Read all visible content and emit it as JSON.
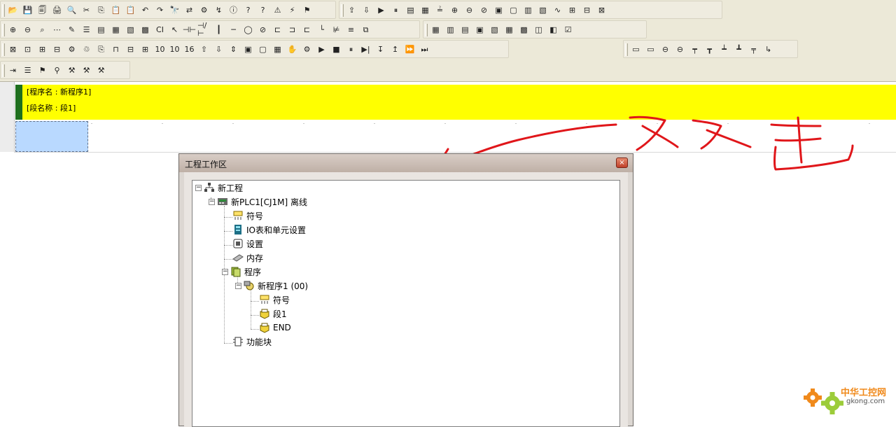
{
  "toolbar": {
    "row1": [
      {
        "name": "open-icon",
        "glyph": "📂"
      },
      {
        "name": "save-icon",
        "glyph": "💾"
      },
      {
        "name": "compare-icon",
        "glyph": "🗐"
      },
      {
        "name": "print-icon",
        "glyph": "🖨"
      },
      {
        "name": "print-preview-icon",
        "glyph": "🔍"
      },
      {
        "name": "cut-icon",
        "glyph": "✂"
      },
      {
        "name": "copy-icon",
        "glyph": "⎘"
      },
      {
        "name": "paste-icon",
        "glyph": "📋"
      },
      {
        "name": "paste-special-icon",
        "glyph": "📋"
      },
      {
        "name": "undo-icon",
        "glyph": "↶"
      },
      {
        "name": "redo-icon",
        "glyph": "↷"
      },
      {
        "name": "find-icon",
        "glyph": "🔭"
      },
      {
        "name": "replace-icon",
        "glyph": "⇄"
      },
      {
        "name": "cross-reference-icon",
        "glyph": "⚙"
      },
      {
        "name": "jump-icon",
        "glyph": "↯"
      },
      {
        "name": "about-icon",
        "glyph": "ⓘ"
      },
      {
        "name": "help-icon",
        "glyph": "?"
      },
      {
        "name": "context-help-icon",
        "glyph": "?"
      },
      {
        "name": "warning-icon",
        "glyph": "⚠"
      },
      {
        "name": "online-icon",
        "glyph": "⚡"
      },
      {
        "name": "monitor-icon",
        "glyph": "⚑"
      },
      {
        "name": "transfer-to-plc-icon",
        "glyph": "⇪"
      },
      {
        "name": "transfer-from-plc-icon",
        "glyph": "⇩"
      },
      {
        "name": "run-mode-icon",
        "glyph": "▶"
      },
      {
        "name": "pause-icon",
        "glyph": "⏸"
      },
      {
        "name": "program-mode-icon",
        "glyph": "▤"
      },
      {
        "name": "monitor-mode-icon",
        "glyph": "▦"
      },
      {
        "name": "compare-plc-icon",
        "glyph": "≟"
      },
      {
        "name": "force-on-icon",
        "glyph": "⊕"
      },
      {
        "name": "force-off-icon",
        "glyph": "⊖"
      },
      {
        "name": "force-cancel-icon",
        "glyph": "⊘"
      },
      {
        "name": "set-icon",
        "glyph": "▣"
      },
      {
        "name": "reset-icon",
        "glyph": "▢"
      },
      {
        "name": "change-value-icon",
        "glyph": "▥"
      },
      {
        "name": "differential-icon",
        "glyph": "▧"
      },
      {
        "name": "trace-icon",
        "glyph": "∿"
      },
      {
        "name": "time-chart-icon",
        "glyph": "⊞"
      },
      {
        "name": "data-trace-icon",
        "glyph": "⊟"
      },
      {
        "name": "io-monitor-icon",
        "glyph": "⊠"
      }
    ],
    "row2": [
      {
        "name": "zoom-in-icon",
        "glyph": "⊕"
      },
      {
        "name": "zoom-out-icon",
        "glyph": "⊖"
      },
      {
        "name": "zoom-fit-icon",
        "glyph": "⌕"
      },
      {
        "name": "grid-icon",
        "glyph": "⋯"
      },
      {
        "name": "comment-icon",
        "glyph": "✎"
      },
      {
        "name": "rung-comment-icon",
        "glyph": "☰"
      },
      {
        "name": "io-comment-icon",
        "glyph": "▤"
      },
      {
        "name": "program-window-icon",
        "glyph": "▦"
      },
      {
        "name": "section-icon",
        "glyph": "▧"
      },
      {
        "name": "symbol-table-icon",
        "glyph": "▩"
      },
      {
        "name": "ci-icon",
        "glyph": "CI"
      },
      {
        "name": "select-icon",
        "glyph": "↖"
      },
      {
        "name": "contact-no-icon",
        "glyph": "⊣⊢"
      },
      {
        "name": "contact-nc-icon",
        "glyph": "⊣/⊢"
      },
      {
        "name": "vertical-line-icon",
        "glyph": "┃"
      },
      {
        "name": "horizontal-line-icon",
        "glyph": "─"
      },
      {
        "name": "coil-icon",
        "glyph": "◯"
      },
      {
        "name": "coil-nc-icon",
        "glyph": "⊘"
      },
      {
        "name": "instruction-icon",
        "glyph": "⊏"
      },
      {
        "name": "pt-icon",
        "glyph": "⊐"
      },
      {
        "name": "jump-line-icon",
        "glyph": "⊏"
      },
      {
        "name": "line-connect-icon",
        "glyph": "└"
      },
      {
        "name": "line-delete-icon",
        "glyph": "⊭"
      },
      {
        "name": "mnemonic-icon",
        "glyph": "≡"
      },
      {
        "name": "build-icon",
        "glyph": "⧉"
      },
      {
        "name": "compile-icon",
        "glyph": "▦"
      },
      {
        "name": "local-var-icon",
        "glyph": "▥"
      },
      {
        "name": "global-var-icon",
        "glyph": "▤"
      },
      {
        "name": "variable-icon",
        "glyph": "▣"
      },
      {
        "name": "output-icon",
        "glyph": "▧"
      },
      {
        "name": "io-table-icon",
        "glyph": "▦"
      },
      {
        "name": "cross-ref-window-icon",
        "glyph": "▩"
      },
      {
        "name": "watch-icon",
        "glyph": "◫"
      },
      {
        "name": "memory-icon",
        "glyph": "◧"
      },
      {
        "name": "settings-icon",
        "glyph": "☑"
      }
    ],
    "row3": [
      {
        "name": "project-workspace-icon",
        "glyph": "⊠"
      },
      {
        "name": "output-window-icon",
        "glyph": "⊡"
      },
      {
        "name": "watch-window-icon",
        "glyph": "⊞"
      },
      {
        "name": "address-window-icon",
        "glyph": "⊟"
      },
      {
        "name": "properties-icon",
        "glyph": "⚙"
      },
      {
        "name": "view-symbols-icon",
        "glyph": "♲"
      },
      {
        "name": "view-comments-icon",
        "glyph": "⎘"
      },
      {
        "name": "view-rung-icon",
        "glyph": "⊓"
      },
      {
        "name": "view-bar-icon",
        "glyph": "⊟"
      },
      {
        "name": "view-table-icon",
        "glyph": "⊞"
      },
      {
        "name": "view-10-icon",
        "glyph": "10"
      },
      {
        "name": "view-10b-icon",
        "glyph": "10"
      },
      {
        "name": "view-16-icon",
        "glyph": "16"
      },
      {
        "name": "transfer-up-icon",
        "glyph": "⇧"
      },
      {
        "name": "transfer-down-icon",
        "glyph": "⇩"
      },
      {
        "name": "transfer-compare-icon",
        "glyph": "⇕"
      },
      {
        "name": "plc-online-icon",
        "glyph": "▣"
      },
      {
        "name": "plc-offline-icon",
        "glyph": "▢"
      },
      {
        "name": "plc-monitor-icon",
        "glyph": "▦"
      },
      {
        "name": "hand-icon",
        "glyph": "✋"
      },
      {
        "name": "sim-icon",
        "glyph": "⚙"
      },
      {
        "name": "play-icon",
        "glyph": "▶"
      },
      {
        "name": "stop-icon",
        "glyph": "■"
      },
      {
        "name": "pause-icon-2",
        "glyph": "⏸"
      },
      {
        "name": "step-in-icon",
        "glyph": "▶|"
      },
      {
        "name": "step-over-icon",
        "glyph": "↧"
      },
      {
        "name": "step-out-icon",
        "glyph": "↥"
      },
      {
        "name": "continuous-step-icon",
        "glyph": "⏩"
      },
      {
        "name": "scan-icon",
        "glyph": "⏭"
      }
    ],
    "row3b": [
      {
        "name": "insert-row-icon",
        "glyph": "▭"
      },
      {
        "name": "insert-column-icon",
        "glyph": "▭"
      },
      {
        "name": "delete-row-icon",
        "glyph": "⊖"
      },
      {
        "name": "delete-column-icon",
        "glyph": "⊖"
      },
      {
        "name": "insert-rung-icon",
        "glyph": "┯"
      },
      {
        "name": "append-rung-icon",
        "glyph": "┳"
      },
      {
        "name": "split-rung-icon",
        "glyph": "┷"
      },
      {
        "name": "merge-rung-icon",
        "glyph": "┻"
      },
      {
        "name": "rung-marker-icon",
        "glyph": "╤"
      },
      {
        "name": "return-icon",
        "glyph": "↳"
      }
    ],
    "row4": [
      {
        "name": "indent-icon",
        "glyph": "⇥"
      },
      {
        "name": "list-icon",
        "glyph": "☰"
      },
      {
        "name": "bookmark-icon",
        "glyph": "⚑"
      },
      {
        "name": "tool-pin-icon",
        "glyph": "⚲"
      },
      {
        "name": "tool-a-icon",
        "glyph": "⚒"
      },
      {
        "name": "tool-b-icon",
        "glyph": "⚒"
      },
      {
        "name": "tool-c-icon",
        "glyph": "⚒"
      }
    ]
  },
  "editor": {
    "program_name_line": "[程序名 : 新程序1]",
    "section_name_line": "[段名称 : 段1]"
  },
  "annotation": {
    "text": "双击",
    "color": "#e0161a"
  },
  "workspace": {
    "title": "工程工作区",
    "close_glyph": "×",
    "tree": [
      {
        "id": "project",
        "label": "新工程",
        "icon": "network-icon",
        "expander": "−"
      },
      {
        "id": "plc",
        "label": "新PLC1[CJ1M] 离线",
        "icon": "plc-icon",
        "expander": "−"
      },
      {
        "id": "symbols",
        "label": "符号",
        "icon": "symbols-icon"
      },
      {
        "id": "io-table",
        "label": "IO表和单元设置",
        "icon": "io-table-icon"
      },
      {
        "id": "settings",
        "label": "设置",
        "icon": "settings-icon"
      },
      {
        "id": "memory",
        "label": "内存",
        "icon": "memory-icon"
      },
      {
        "id": "programs",
        "label": "程序",
        "icon": "programs-icon",
        "expander": "−"
      },
      {
        "id": "new-program",
        "label": "新程序1 (00)",
        "icon": "program-icon",
        "expander": "−"
      },
      {
        "id": "program-symbols",
        "label": "符号",
        "icon": "symbols-icon"
      },
      {
        "id": "section1",
        "label": "段1",
        "icon": "section-icon"
      },
      {
        "id": "end",
        "label": "END",
        "icon": "section-icon"
      },
      {
        "id": "function-blocks",
        "label": "功能块",
        "icon": "function-block-icon"
      }
    ]
  },
  "watermark": {
    "text_cn": "中华工控网",
    "text_en": "gkong.com"
  },
  "colors": {
    "header_band": "#ffff00",
    "header_marker": "#1e6f1e",
    "cursor_cell": "#b9d9ff",
    "annotation": "#e0161a",
    "watermark": "#f08a1c"
  }
}
